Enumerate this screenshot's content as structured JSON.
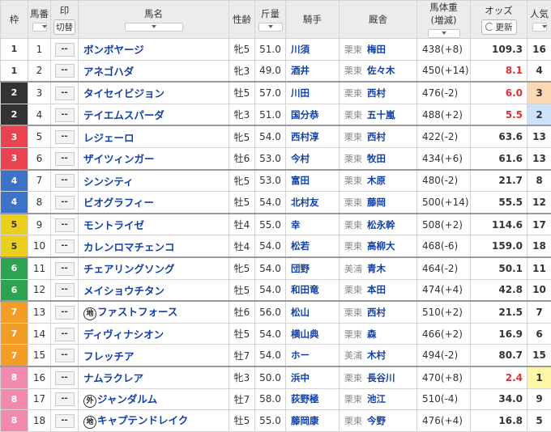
{
  "header": {
    "waku": "枠",
    "umaban": "馬番",
    "mark": "印",
    "mark_toggle": "切替",
    "name": "馬名",
    "sexage": "性齢",
    "kinryo": "斤量",
    "jockey": "騎手",
    "trainer": "厩舎",
    "weight": "馬体重",
    "weight_sub": "(増減)",
    "odds": "オッズ",
    "refresh": "更新",
    "pop": "人気"
  },
  "colors": {
    "waku1": "#ffffff",
    "waku2": "#333333",
    "waku3": "#e8434f",
    "waku4": "#3b73c8",
    "waku5": "#ebcf1e",
    "waku6": "#2ca34f",
    "waku7": "#f39c26",
    "waku8": "#f28ab0",
    "link": "#1240a8",
    "odds_hot": "#e03030"
  },
  "horses": [
    {
      "waku": "1",
      "num": "1",
      "mark": "--",
      "badge": "",
      "name": "ボンボヤージ",
      "sexage": "牝5",
      "kinryo": "51.0",
      "jockey": "川須",
      "region": "栗東",
      "trainer": "梅田",
      "weight": "438(+8)",
      "odds": "109.3",
      "pop": "16"
    },
    {
      "waku": "1",
      "num": "2",
      "mark": "--",
      "badge": "",
      "name": "アネゴハダ",
      "sexage": "牝3",
      "kinryo": "49.0",
      "jockey": "酒井",
      "region": "栗東",
      "trainer": "佐々木",
      "weight": "450(+14)",
      "odds": "8.1",
      "pop": "4"
    },
    {
      "waku": "2",
      "num": "3",
      "mark": "--",
      "badge": "",
      "name": "タイセイビジョン",
      "sexage": "牡5",
      "kinryo": "57.0",
      "jockey": "川田",
      "region": "栗東",
      "trainer": "西村",
      "weight": "476(-2)",
      "odds": "6.0",
      "pop": "3"
    },
    {
      "waku": "2",
      "num": "4",
      "mark": "--",
      "badge": "",
      "name": "テイエムスパーダ",
      "sexage": "牝3",
      "kinryo": "51.0",
      "jockey": "国分恭",
      "region": "栗東",
      "trainer": "五十嵐",
      "weight": "488(+2)",
      "odds": "5.5",
      "pop": "2"
    },
    {
      "waku": "3",
      "num": "5",
      "mark": "--",
      "badge": "",
      "name": "レジェーロ",
      "sexage": "牝5",
      "kinryo": "54.0",
      "jockey": "西村淳",
      "region": "栗東",
      "trainer": "西村",
      "weight": "422(-2)",
      "odds": "63.6",
      "pop": "13"
    },
    {
      "waku": "3",
      "num": "6",
      "mark": "--",
      "badge": "",
      "name": "ザイツィンガー",
      "sexage": "牡6",
      "kinryo": "53.0",
      "jockey": "今村",
      "region": "栗東",
      "trainer": "牧田",
      "weight": "434(+6)",
      "odds": "61.6",
      "pop": "13"
    },
    {
      "waku": "4",
      "num": "7",
      "mark": "--",
      "badge": "",
      "name": "シンシティ",
      "sexage": "牝5",
      "kinryo": "53.0",
      "jockey": "富田",
      "region": "栗東",
      "trainer": "木原",
      "weight": "480(-2)",
      "odds": "21.7",
      "pop": "8"
    },
    {
      "waku": "4",
      "num": "8",
      "mark": "--",
      "badge": "",
      "name": "ビオグラフィー",
      "sexage": "牡5",
      "kinryo": "54.0",
      "jockey": "北村友",
      "region": "栗東",
      "trainer": "藤岡",
      "weight": "500(+14)",
      "odds": "55.5",
      "pop": "12"
    },
    {
      "waku": "5",
      "num": "9",
      "mark": "--",
      "badge": "",
      "name": "モントライゼ",
      "sexage": "牡4",
      "kinryo": "55.0",
      "jockey": "幸",
      "region": "栗東",
      "trainer": "松永幹",
      "weight": "508(+2)",
      "odds": "114.6",
      "pop": "17"
    },
    {
      "waku": "5",
      "num": "10",
      "mark": "--",
      "badge": "",
      "name": "カレンロマチェンコ",
      "sexage": "牡4",
      "kinryo": "54.0",
      "jockey": "松若",
      "region": "栗東",
      "trainer": "高柳大",
      "weight": "468(-6)",
      "odds": "159.0",
      "pop": "18"
    },
    {
      "waku": "6",
      "num": "11",
      "mark": "--",
      "badge": "",
      "name": "チェアリングソング",
      "sexage": "牝5",
      "kinryo": "54.0",
      "jockey": "団野",
      "region": "美浦",
      "trainer": "青木",
      "weight": "464(-2)",
      "odds": "50.1",
      "pop": "11"
    },
    {
      "waku": "6",
      "num": "12",
      "mark": "--",
      "badge": "",
      "name": "メイショウチタン",
      "sexage": "牡5",
      "kinryo": "54.0",
      "jockey": "和田竜",
      "region": "栗東",
      "trainer": "本田",
      "weight": "474(+4)",
      "odds": "42.8",
      "pop": "10"
    },
    {
      "waku": "7",
      "num": "13",
      "mark": "--",
      "badge": "地",
      "name": "ファストフォース",
      "sexage": "牡6",
      "kinryo": "56.0",
      "jockey": "松山",
      "region": "栗東",
      "trainer": "西村",
      "weight": "510(+2)",
      "odds": "21.5",
      "pop": "7"
    },
    {
      "waku": "7",
      "num": "14",
      "mark": "--",
      "badge": "",
      "name": "ディヴィナシオン",
      "sexage": "牡5",
      "kinryo": "54.0",
      "jockey": "横山典",
      "region": "栗東",
      "trainer": "森",
      "weight": "466(+2)",
      "odds": "16.9",
      "pop": "6"
    },
    {
      "waku": "7",
      "num": "15",
      "mark": "--",
      "badge": "",
      "name": "フレッチア",
      "sexage": "牡7",
      "kinryo": "54.0",
      "jockey": "ホー",
      "region": "美浦",
      "trainer": "木村",
      "weight": "494(-2)",
      "odds": "80.7",
      "pop": "15"
    },
    {
      "waku": "8",
      "num": "16",
      "mark": "--",
      "badge": "",
      "name": "ナムラクレア",
      "sexage": "牝3",
      "kinryo": "50.0",
      "jockey": "浜中",
      "region": "栗東",
      "trainer": "長谷川",
      "weight": "470(+8)",
      "odds": "2.4",
      "pop": "1"
    },
    {
      "waku": "8",
      "num": "17",
      "mark": "--",
      "badge": "外",
      "name": "ジャンダルム",
      "sexage": "牡7",
      "kinryo": "58.0",
      "jockey": "荻野極",
      "region": "栗東",
      "trainer": "池江",
      "weight": "510(-4)",
      "odds": "34.0",
      "pop": "9"
    },
    {
      "waku": "8",
      "num": "18",
      "mark": "--",
      "badge": "地",
      "name": "キャプテンドレイク",
      "sexage": "牡5",
      "kinryo": "55.0",
      "jockey": "藤岡康",
      "region": "栗東",
      "trainer": "今野",
      "weight": "476(+4)",
      "odds": "16.8",
      "pop": "5"
    }
  ]
}
